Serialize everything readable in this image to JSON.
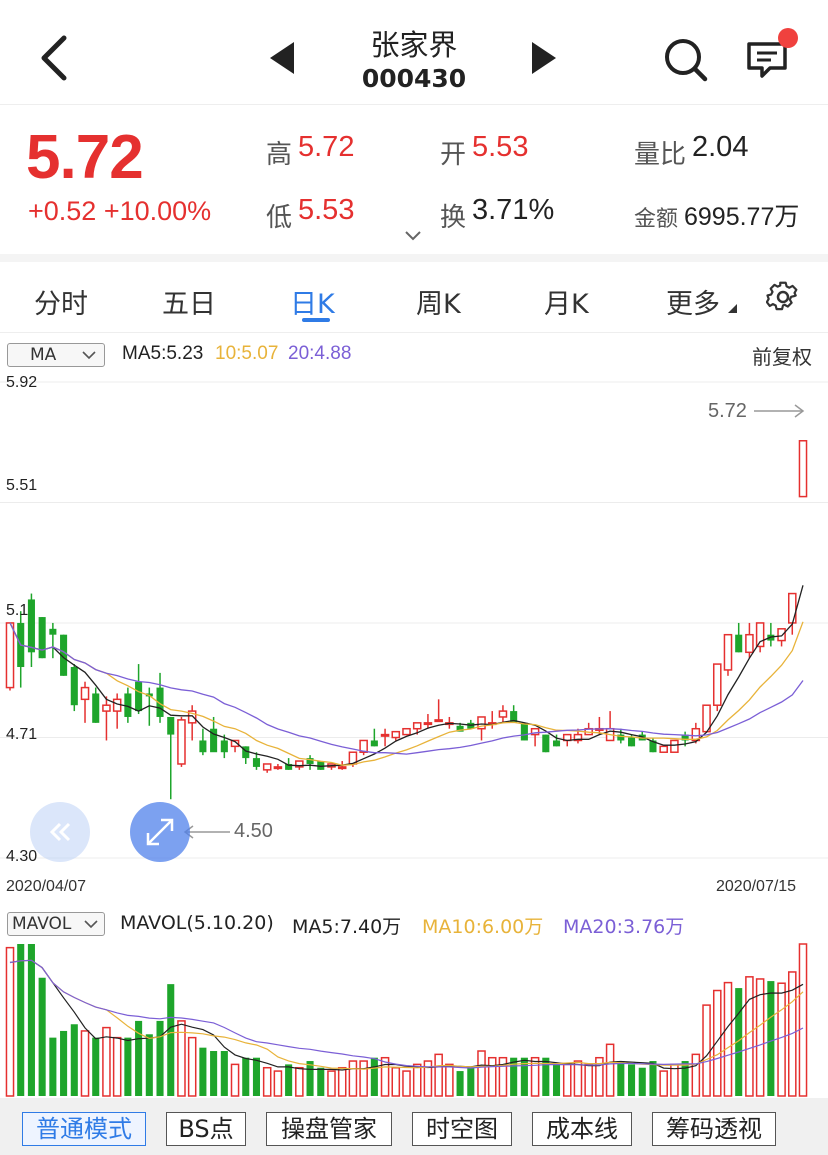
{
  "header": {
    "stock_name": "张家界",
    "stock_code": "000430"
  },
  "quote": {
    "price": "5.72",
    "change": "+0.52 +10.00%",
    "high_label": "高",
    "high": "5.72",
    "low_label": "低",
    "low": "5.53",
    "open_label": "开",
    "open": "5.53",
    "turnover_label": "换",
    "turnover": "3.71%",
    "vol_ratio_label": "量比",
    "vol_ratio": "2.04",
    "amount_label": "金额",
    "amount": "6995.77万"
  },
  "tabs": [
    {
      "label": "分时"
    },
    {
      "label": "五日"
    },
    {
      "label": "日K",
      "active": true
    },
    {
      "label": "周K"
    },
    {
      "label": "月K"
    },
    {
      "label": "更多"
    }
  ],
  "kline": {
    "indicator_select": "MA",
    "ma5": "MA5:5.23",
    "ma10": "10:5.07",
    "ma20": "20:4.88",
    "adjust": "前复权",
    "price_labels": [
      "5.92",
      "5.51",
      "5.1",
      "4.71",
      "4.30"
    ],
    "max_marker": "5.72",
    "min_marker": "4.50",
    "start_date": "2020/04/07",
    "end_date": "2020/07/15"
  },
  "volume": {
    "indicator_select": "MAVOL",
    "title": "MAVOL(5.10.20)",
    "ma5": "MA5:7.40万",
    "ma10": "MA10:6.00万",
    "ma20": "MA20:3.76万"
  },
  "bottom_tabs": [
    {
      "label": "普通模式",
      "active": true
    },
    {
      "label": "BS点"
    },
    {
      "label": "操盘管家"
    },
    {
      "label": "时空图"
    },
    {
      "label": "成本线"
    },
    {
      "label": "筹码透视"
    }
  ],
  "colors": {
    "up": "#e5302f",
    "down": "#1ea52b",
    "ma5": "#222222",
    "ma10": "#e8b33a",
    "ma20": "#7b5fd6",
    "accent": "#2f7be6"
  },
  "chart_data": {
    "type": "candlestick",
    "note_range": "2020/04/07 - 2020/07/15",
    "candles": [
      [
        4.88,
        5.1,
        4.87,
        5.1
      ],
      [
        5.1,
        5.14,
        4.88,
        4.95
      ],
      [
        5.18,
        5.2,
        4.95,
        5.0
      ],
      [
        5.12,
        5.12,
        4.98,
        4.98
      ],
      [
        5.08,
        5.1,
        4.98,
        5.06
      ],
      [
        5.06,
        5.06,
        4.92,
        4.92
      ],
      [
        4.95,
        4.96,
        4.8,
        4.82
      ],
      [
        4.84,
        4.9,
        4.76,
        4.88
      ],
      [
        4.86,
        4.88,
        4.76,
        4.76
      ],
      [
        4.8,
        4.85,
        4.7,
        4.82
      ],
      [
        4.8,
        4.86,
        4.74,
        4.84
      ],
      [
        4.86,
        4.88,
        4.76,
        4.78
      ],
      [
        4.9,
        4.96,
        4.79,
        4.8
      ],
      [
        4.86,
        4.88,
        4.75,
        4.85
      ],
      [
        4.88,
        4.93,
        4.76,
        4.78
      ],
      [
        4.78,
        4.78,
        4.5,
        4.72
      ],
      [
        4.62,
        4.78,
        4.61,
        4.77
      ],
      [
        4.76,
        4.82,
        4.7,
        4.8
      ],
      [
        4.7,
        4.74,
        4.65,
        4.66
      ],
      [
        4.74,
        4.78,
        4.7,
        4.66
      ],
      [
        4.7,
        4.72,
        4.64,
        4.66
      ],
      [
        4.68,
        4.7,
        4.66,
        4.7
      ],
      [
        4.68,
        4.68,
        4.62,
        4.64
      ],
      [
        4.64,
        4.66,
        4.6,
        4.61
      ],
      [
        4.6,
        4.62,
        4.59,
        4.62
      ],
      [
        4.61,
        4.62,
        4.6,
        4.61
      ],
      [
        4.62,
        4.64,
        4.6,
        4.6
      ],
      [
        4.61,
        4.63,
        4.6,
        4.63
      ],
      [
        4.64,
        4.65,
        4.6,
        4.62
      ],
      [
        4.63,
        4.63,
        4.6,
        4.6
      ],
      [
        4.61,
        4.62,
        4.6,
        4.62
      ],
      [
        4.61,
        4.63,
        4.6,
        4.61
      ],
      [
        4.62,
        4.66,
        4.61,
        4.66
      ],
      [
        4.66,
        4.7,
        4.65,
        4.7
      ],
      [
        4.7,
        4.74,
        4.68,
        4.68
      ],
      [
        4.72,
        4.74,
        4.68,
        4.72
      ],
      [
        4.71,
        4.73,
        4.7,
        4.73
      ],
      [
        4.72,
        4.74,
        4.72,
        4.74
      ],
      [
        4.74,
        4.76,
        4.72,
        4.76
      ],
      [
        4.76,
        4.79,
        4.74,
        4.76
      ],
      [
        4.77,
        4.84,
        4.77,
        4.77
      ],
      [
        4.76,
        4.78,
        4.74,
        4.76
      ],
      [
        4.75,
        4.76,
        4.74,
        4.73
      ],
      [
        4.76,
        4.77,
        4.74,
        4.74
      ],
      [
        4.74,
        4.78,
        4.7,
        4.78
      ],
      [
        4.76,
        4.8,
        4.74,
        4.76
      ],
      [
        4.78,
        4.82,
        4.76,
        4.8
      ],
      [
        4.8,
        4.82,
        4.76,
        4.76
      ],
      [
        4.76,
        4.76,
        4.7,
        4.7
      ],
      [
        4.72,
        4.74,
        4.68,
        4.74
      ],
      [
        4.72,
        4.72,
        4.66,
        4.66
      ],
      [
        4.7,
        4.72,
        4.68,
        4.68
      ],
      [
        4.7,
        4.72,
        4.68,
        4.72
      ],
      [
        4.7,
        4.74,
        4.69,
        4.72
      ],
      [
        4.72,
        4.76,
        4.72,
        4.74
      ],
      [
        4.74,
        4.78,
        4.72,
        4.74
      ],
      [
        4.7,
        4.8,
        4.7,
        4.74
      ],
      [
        4.72,
        4.74,
        4.69,
        4.7
      ],
      [
        4.71,
        4.72,
        4.68,
        4.68
      ],
      [
        4.72,
        4.73,
        4.7,
        4.7
      ],
      [
        4.7,
        4.71,
        4.66,
        4.66
      ],
      [
        4.66,
        4.68,
        4.66,
        4.68
      ],
      [
        4.66,
        4.7,
        4.66,
        4.7
      ],
      [
        4.72,
        4.73,
        4.68,
        4.7
      ],
      [
        4.7,
        4.76,
        4.69,
        4.74
      ],
      [
        4.73,
        4.82,
        4.73,
        4.82
      ],
      [
        4.82,
        4.92,
        4.8,
        4.96
      ],
      [
        4.94,
        5.05,
        4.92,
        5.06
      ],
      [
        5.06,
        5.1,
        5.0,
        5.0
      ],
      [
        5.0,
        5.1,
        4.98,
        5.06
      ],
      [
        5.02,
        5.1,
        5.0,
        5.1
      ],
      [
        5.06,
        5.1,
        5.02,
        5.04
      ],
      [
        5.04,
        5.08,
        5.02,
        5.08
      ],
      [
        5.1,
        5.14,
        5.06,
        5.2
      ],
      [
        5.53,
        5.72,
        5.53,
        5.72
      ]
    ]
  }
}
